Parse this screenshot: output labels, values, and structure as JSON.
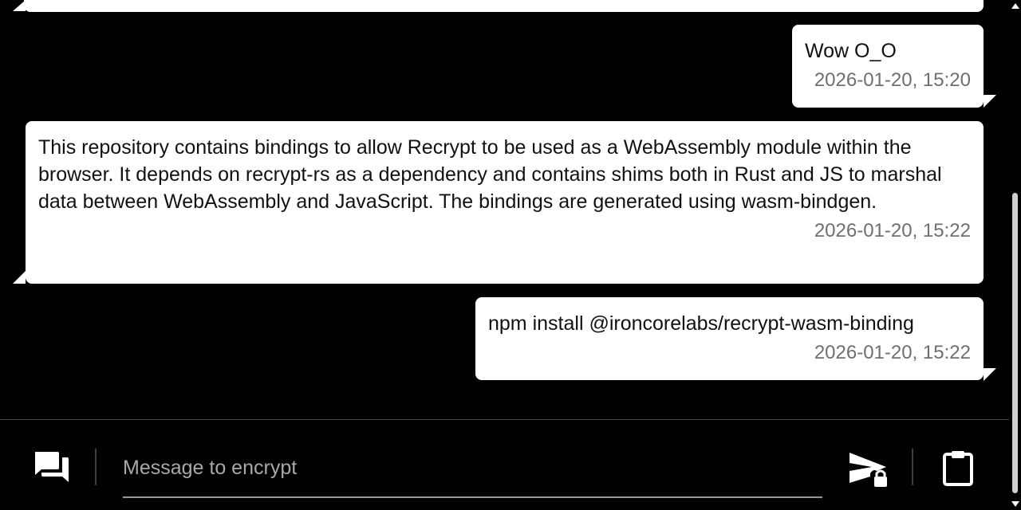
{
  "conversation": {
    "messages": [
      {
        "sender": "self",
        "text": "Wow O_O",
        "timestamp": "2026-01-20, 15:20"
      },
      {
        "sender": "other",
        "text": "This repository contains bindings to allow Recrypt to be used as a WebAssembly module within the browser. It depends on recrypt-rs as a dependency and contains shims both in Rust and JS to marshal data between WebAssembly and JavaScript. The bindings are generated using wasm-bindgen.",
        "timestamp": "2026-01-20, 15:22"
      },
      {
        "sender": "self",
        "text": "npm install @ironcorelabs/recrypt-wasm-binding",
        "timestamp": "2026-01-20, 15:22"
      }
    ]
  },
  "composer": {
    "placeholder": "Message to encrypt",
    "value": "",
    "icons": {
      "left": "chat-bubbles-icon",
      "send": "send-encrypted-icon",
      "right": "clipboard-icon"
    }
  },
  "theme": {
    "background": "#000000",
    "bubble": "#ffffff",
    "text": "#111111",
    "timestamp": "#6f6f6f"
  }
}
